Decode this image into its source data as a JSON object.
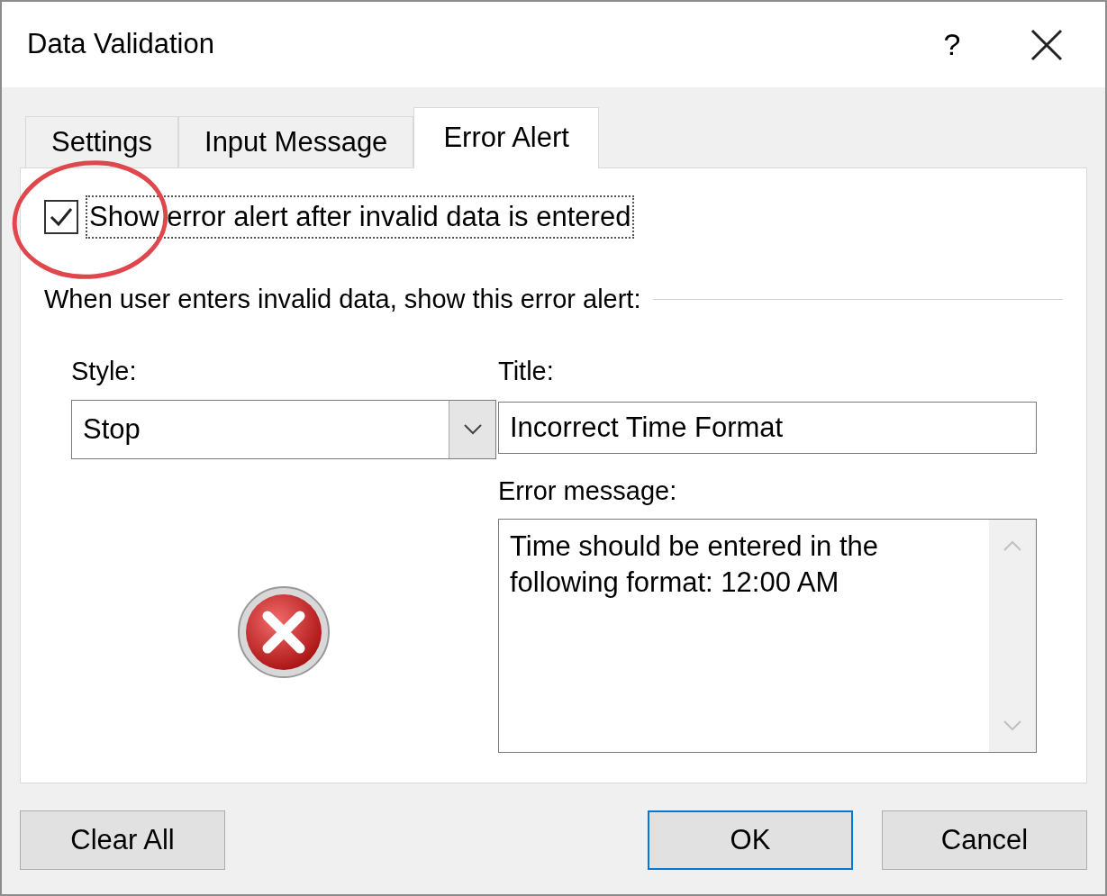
{
  "window": {
    "title": "Data Validation",
    "help": "?"
  },
  "tabs": [
    {
      "label": "Settings",
      "selected": false
    },
    {
      "label": "Input Message",
      "selected": false
    },
    {
      "label": "Error Alert",
      "selected": true
    }
  ],
  "show_alert": {
    "label": "Show error alert after invalid data is entered",
    "checked": true
  },
  "group_heading": "When user enters invalid data, show this error alert:",
  "style": {
    "label": "Style:",
    "value": "Stop"
  },
  "title_field": {
    "label": "Title:",
    "value": "Incorrect Time Format"
  },
  "error_message": {
    "label": "Error message:",
    "value": "Time should be entered in the following format: 12:00 AM"
  },
  "buttons": [
    {
      "label": "Clear All",
      "default": false
    },
    {
      "label": "OK",
      "default": true
    },
    {
      "label": "Cancel",
      "default": false
    }
  ]
}
